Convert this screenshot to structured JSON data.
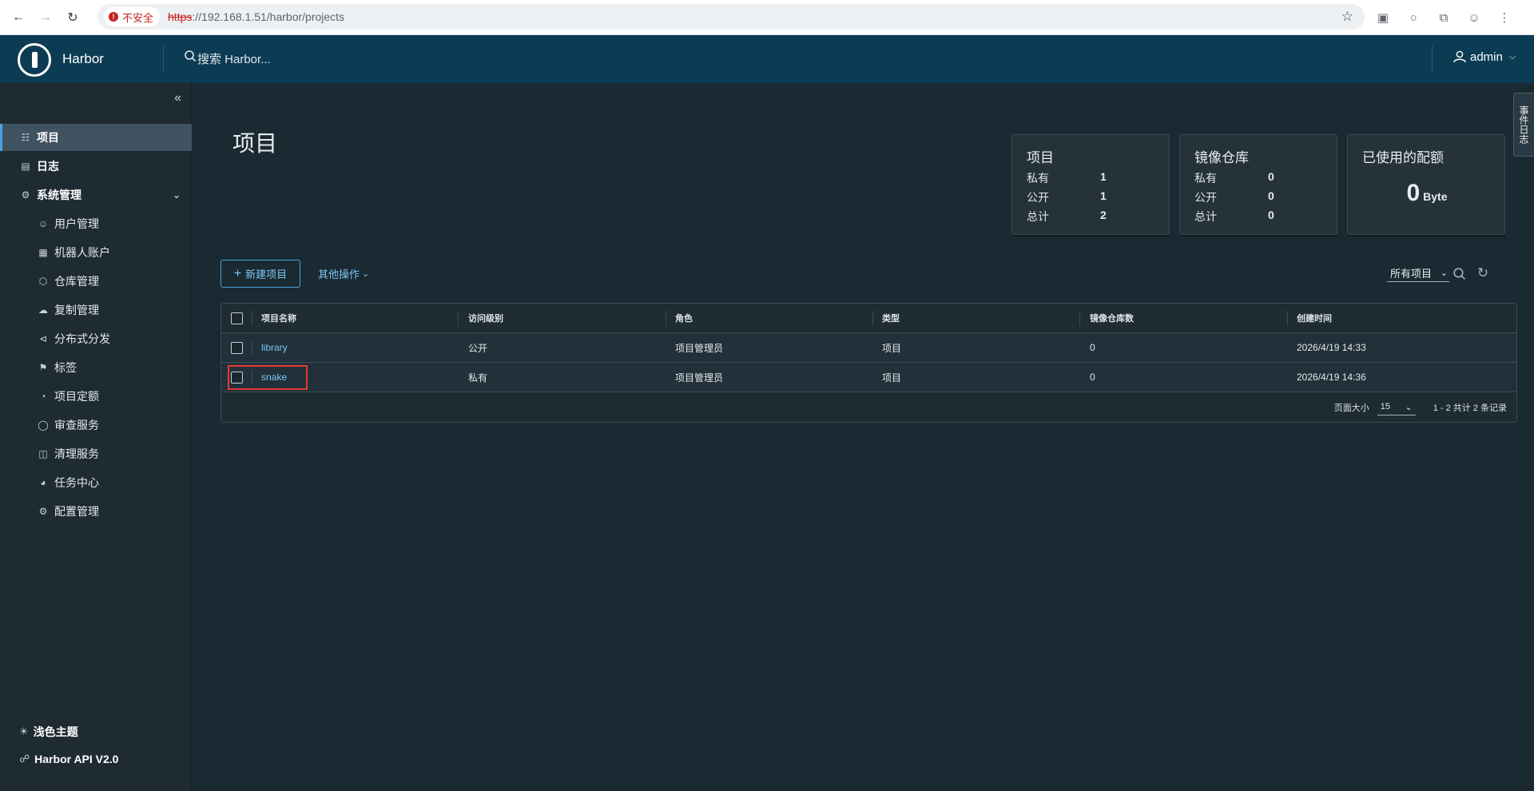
{
  "browser": {
    "security_label": "不安全",
    "url_scheme": "https",
    "url_rest": "://192.168.1.51/harbor/projects"
  },
  "header": {
    "app_name": "Harbor",
    "search_placeholder": "搜索 Harbor...",
    "user": "admin"
  },
  "sidebar": {
    "items": [
      {
        "label": "项目",
        "icon": "projects-icon"
      },
      {
        "label": "日志",
        "icon": "logs-icon"
      },
      {
        "label": "系统管理",
        "icon": "admin-icon"
      }
    ],
    "sub_items": [
      {
        "label": "用户管理",
        "icon": "users-icon"
      },
      {
        "label": "机器人账户",
        "icon": "robot-icon"
      },
      {
        "label": "仓库管理",
        "icon": "registry-icon"
      },
      {
        "label": "复制管理",
        "icon": "replication-icon"
      },
      {
        "label": "分布式分发",
        "icon": "distribution-icon"
      },
      {
        "label": "标签",
        "icon": "tag-icon"
      },
      {
        "label": "项目定额",
        "icon": "quota-icon"
      },
      {
        "label": "审查服务",
        "icon": "shield-icon"
      },
      {
        "label": "清理服务",
        "icon": "trash-icon"
      },
      {
        "label": "任务中心",
        "icon": "dashboard-icon"
      },
      {
        "label": "配置管理",
        "icon": "gear-icon"
      }
    ],
    "footer": {
      "theme": "浅色主题",
      "api": "Harbor API V2.0"
    }
  },
  "main": {
    "title": "项目",
    "cards": {
      "projects": {
        "title": "项目",
        "private_label": "私有",
        "private_val": "1",
        "public_label": "公开",
        "public_val": "1",
        "total_label": "总计",
        "total_val": "2"
      },
      "repos": {
        "title": "镜像仓库",
        "private_label": "私有",
        "private_val": "0",
        "public_label": "公开",
        "public_val": "0",
        "total_label": "总计",
        "total_val": "0"
      },
      "quota": {
        "title": "已使用的配额",
        "value": "0",
        "unit": "Byte"
      }
    },
    "toolbar": {
      "new_project": "新建项目",
      "other_actions": "其他操作",
      "filter": "所有项目"
    },
    "table": {
      "columns": [
        "项目名称",
        "访问级别",
        "角色",
        "类型",
        "镜像仓库数",
        "创建时间"
      ],
      "rows": [
        {
          "name": "library",
          "access": "公开",
          "role": "项目管理员",
          "type": "项目",
          "repos": "0",
          "created": "2026/4/19 14:33"
        },
        {
          "name": "snake",
          "access": "私有",
          "role": "项目管理员",
          "type": "项目",
          "repos": "0",
          "created": "2026/4/19 14:36"
        }
      ],
      "footer": {
        "page_size_label": "页面大小",
        "page_size": "15",
        "info": "1 - 2 共计 2 条记录"
      }
    },
    "side_tab": "事件日志"
  }
}
